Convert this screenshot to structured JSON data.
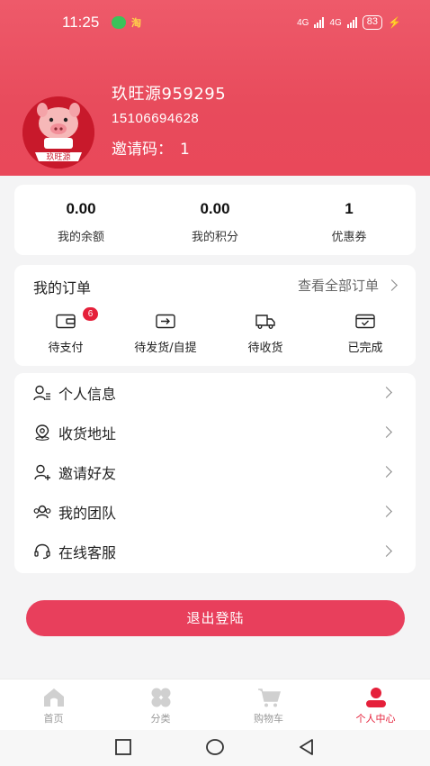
{
  "status_bar": {
    "time": "11:25",
    "app_badge": "淘",
    "network_1": "4G",
    "network_2": "4G",
    "battery": "83"
  },
  "profile": {
    "name": "玖旺源959295",
    "phone": "15106694628",
    "invite_label": "邀请码：",
    "invite_code": "1",
    "avatar_text": "玖旺源"
  },
  "stats": [
    {
      "value": "0.00",
      "label": "我的余额"
    },
    {
      "value": "0.00",
      "label": "我的积分"
    },
    {
      "value": "1",
      "label": "优惠券"
    }
  ],
  "orders": {
    "title": "我的订单",
    "view_all": "查看全部订单",
    "items": [
      {
        "label": "待支付",
        "icon": "wallet-icon",
        "badge": "6"
      },
      {
        "label": "待发货/自提",
        "icon": "box-arrow-icon"
      },
      {
        "label": "待收货",
        "icon": "truck-icon"
      },
      {
        "label": "已完成",
        "icon": "completed-box-icon"
      }
    ]
  },
  "menu": [
    {
      "label": "个人信息",
      "icon": "user-info-icon"
    },
    {
      "label": "收货地址",
      "icon": "location-icon"
    },
    {
      "label": "邀请好友",
      "icon": "add-user-icon"
    },
    {
      "label": "我的团队",
      "icon": "team-icon"
    },
    {
      "label": "在线客服",
      "icon": "headset-icon"
    }
  ],
  "logout_label": "退出登陆",
  "tabbar": [
    {
      "label": "首页",
      "icon": "home-icon",
      "active": false
    },
    {
      "label": "分类",
      "icon": "category-icon",
      "active": false
    },
    {
      "label": "购物车",
      "icon": "cart-icon",
      "active": false
    },
    {
      "label": "个人中心",
      "icon": "profile-icon",
      "active": true
    }
  ],
  "colors": {
    "accent": "#e83f5c",
    "header": "#e9485a",
    "badge": "#e5203a",
    "inactive_tab": "#cccccc"
  }
}
